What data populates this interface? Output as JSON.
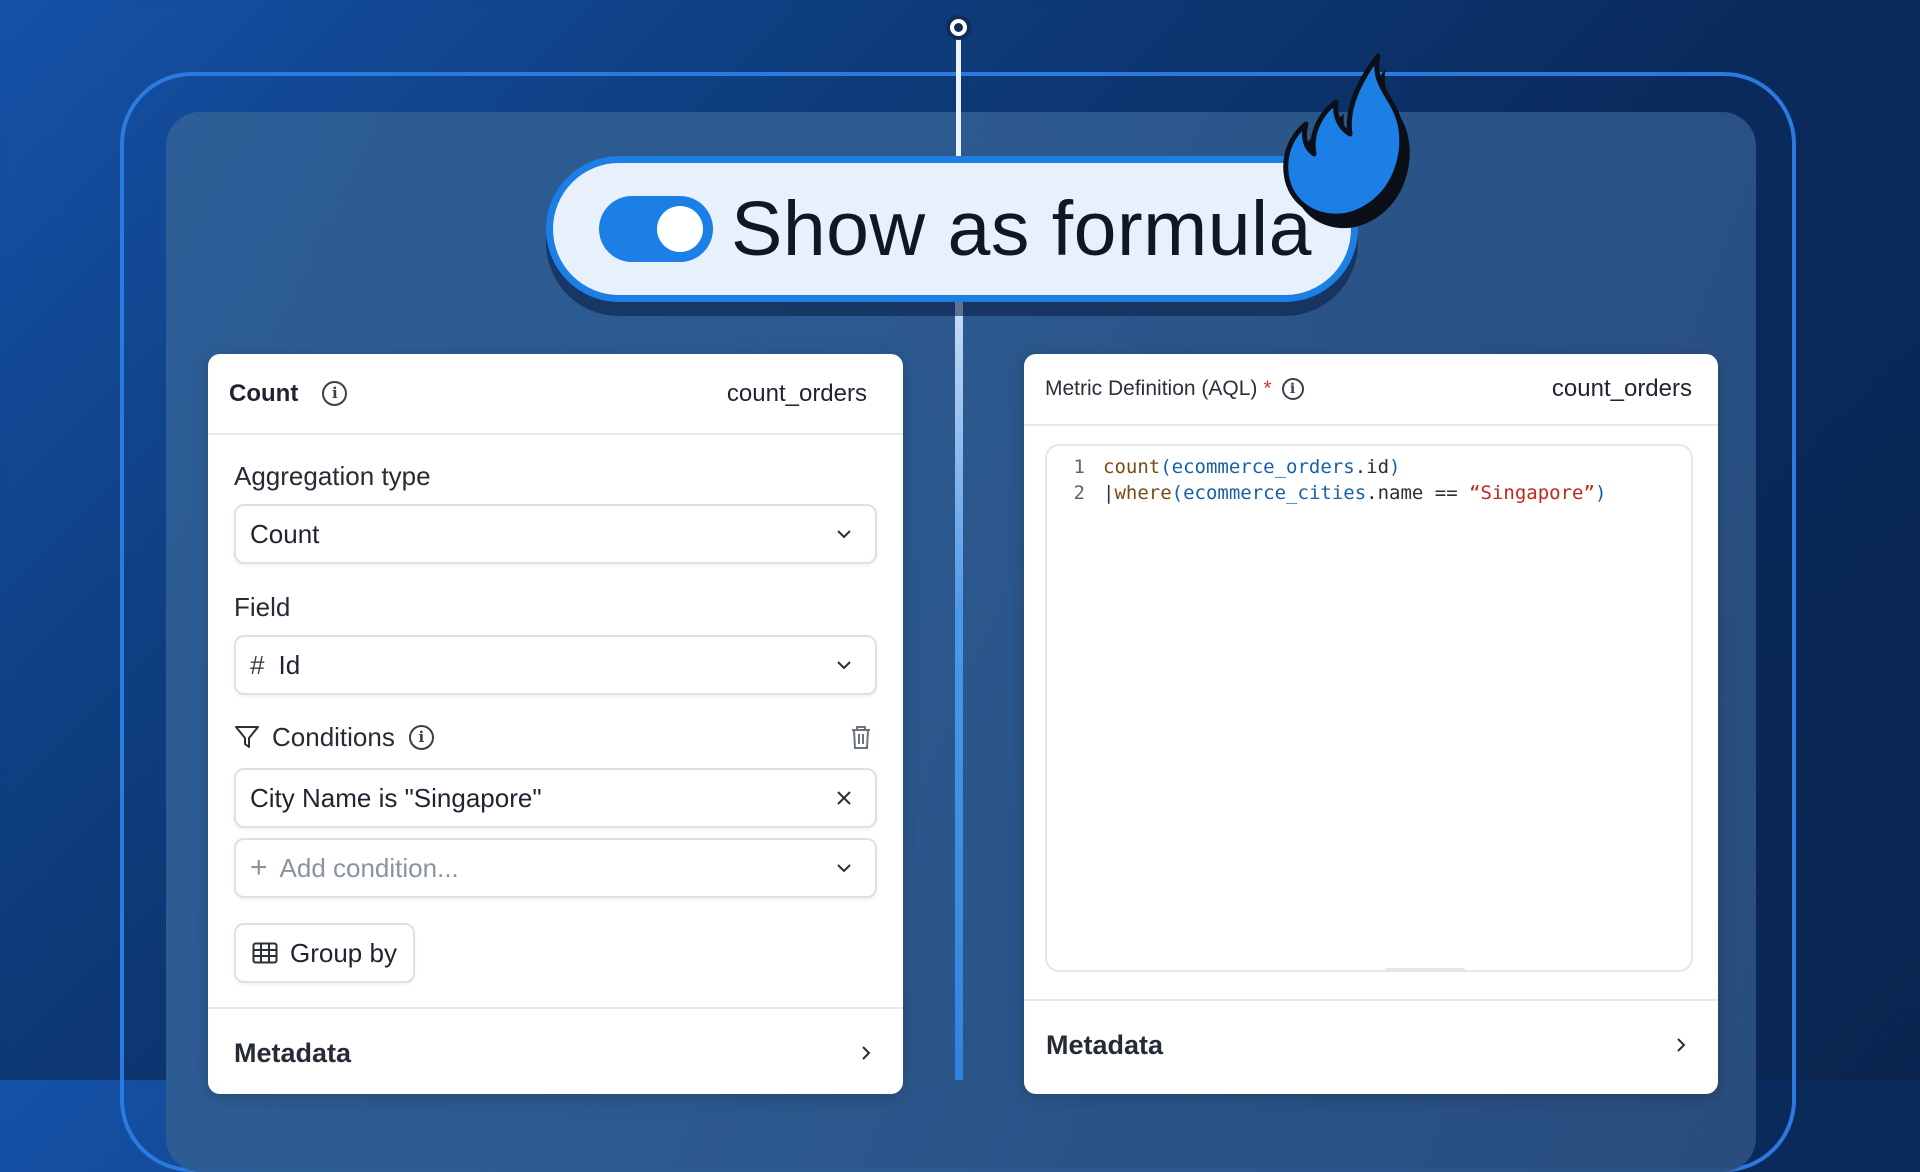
{
  "toggle": {
    "label": "Show as formula",
    "state": "on",
    "accent_color": "#1c7fe6"
  },
  "decoration": {
    "icon": "flame-icon"
  },
  "left_panel": {
    "header": {
      "title": "Count",
      "metric_name": "count_orders"
    },
    "aggregation_type": {
      "label": "Aggregation type",
      "value": "Count"
    },
    "field": {
      "label": "Field",
      "type_glyph": "#",
      "value": "Id"
    },
    "conditions": {
      "label": "Conditions",
      "items": [
        "City Name is \"Singapore\""
      ],
      "add_placeholder": "Add condition..."
    },
    "group_by": {
      "label": "Group by"
    },
    "metadata": {
      "label": "Metadata"
    }
  },
  "right_panel": {
    "header": {
      "title": "Metric Definition (AQL)",
      "required_marker": "*",
      "metric_name": "count_orders"
    },
    "code_lines": [
      {
        "number": "1",
        "tokens": [
          {
            "t": "count",
            "k": "fn"
          },
          {
            "t": "(",
            "k": "id"
          },
          {
            "t": "ecommerce_orders",
            "k": "id"
          },
          {
            "t": ".id",
            "k": "plain"
          },
          {
            "t": ")",
            "k": "id"
          }
        ]
      },
      {
        "number": "2",
        "tokens": [
          {
            "t": "|",
            "k": "plain"
          },
          {
            "t": "where",
            "k": "fn"
          },
          {
            "t": "(",
            "k": "id"
          },
          {
            "t": "ecommerce_cities",
            "k": "id"
          },
          {
            "t": ".name == ",
            "k": "plain"
          },
          {
            "t": "“Singapore”",
            "k": "str"
          },
          {
            "t": ")",
            "k": "id"
          }
        ]
      }
    ],
    "metadata": {
      "label": "Metadata"
    }
  }
}
